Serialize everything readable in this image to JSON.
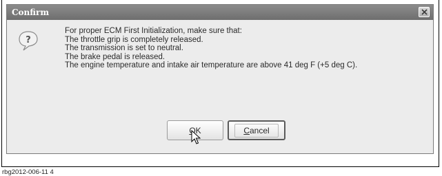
{
  "dialog": {
    "title": "Confirm",
    "message_lines": [
      "For proper ECM First Initialization, make sure that:",
      "The throttle grip is completely released.",
      "The transmission is set to neutral.",
      "The brake pedal is released.",
      "The engine temperature and intake air temperature are above 41 deg F (+5 deg C)."
    ],
    "buttons": {
      "ok_mnemonic": "O",
      "ok_rest": "K",
      "cancel_mnemonic": "C",
      "cancel_rest": "ancel"
    },
    "icons": {
      "close": "close-icon",
      "question": "question-icon",
      "cursor": "mouse-cursor-icon"
    }
  },
  "caption": "rbg2012-006-11 4"
}
